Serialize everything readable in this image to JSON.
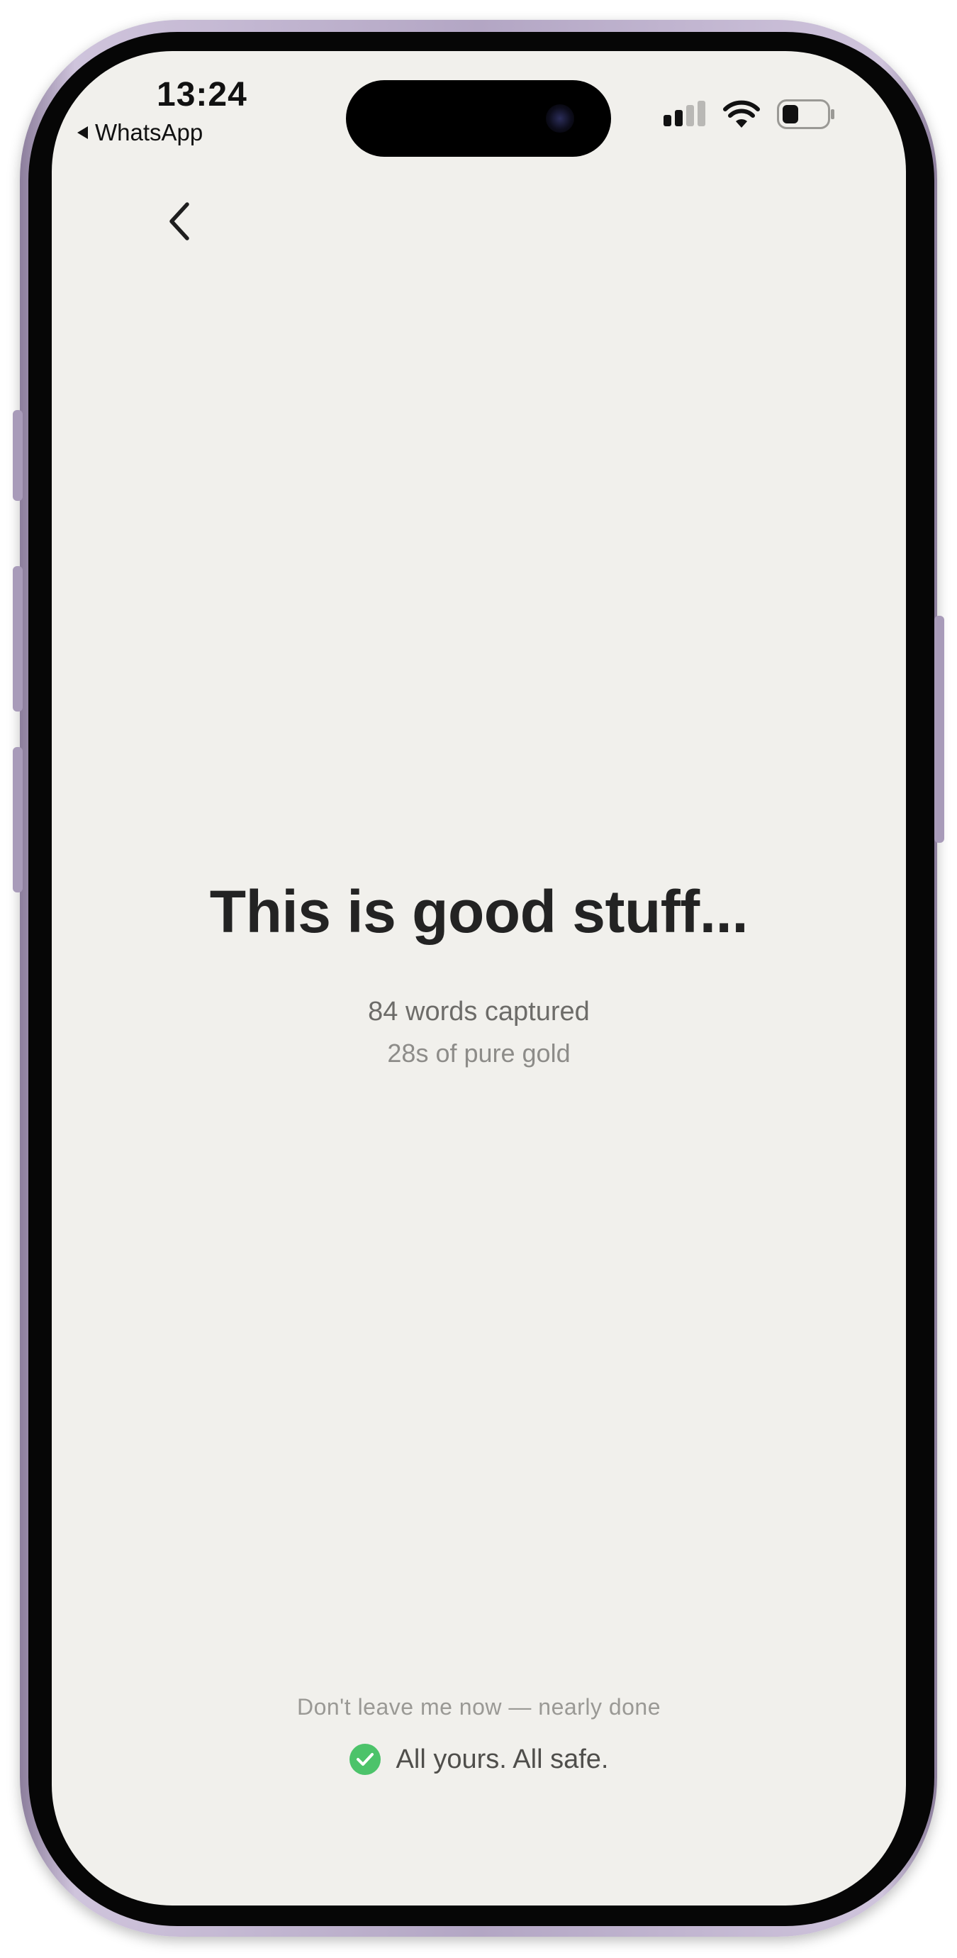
{
  "status_bar": {
    "time": "13:24",
    "back_app": "WhatsApp",
    "icons": [
      "signal-icon",
      "wifi-icon",
      "battery-icon"
    ]
  },
  "nav": {
    "back_icon": "chevron-left-icon"
  },
  "main": {
    "headline": "This is good stuff...",
    "words_captured": "84 words captured",
    "duration": "28s of pure gold"
  },
  "footer": {
    "hint": "Don't leave me now — nearly done",
    "safe_text": "All yours. All safe.",
    "safe_icon": "check-circle-icon"
  },
  "colors": {
    "background": "#f1f0ec",
    "headline": "#232323",
    "check_green": "#4cc36a",
    "frame": "#b3a6c4"
  }
}
